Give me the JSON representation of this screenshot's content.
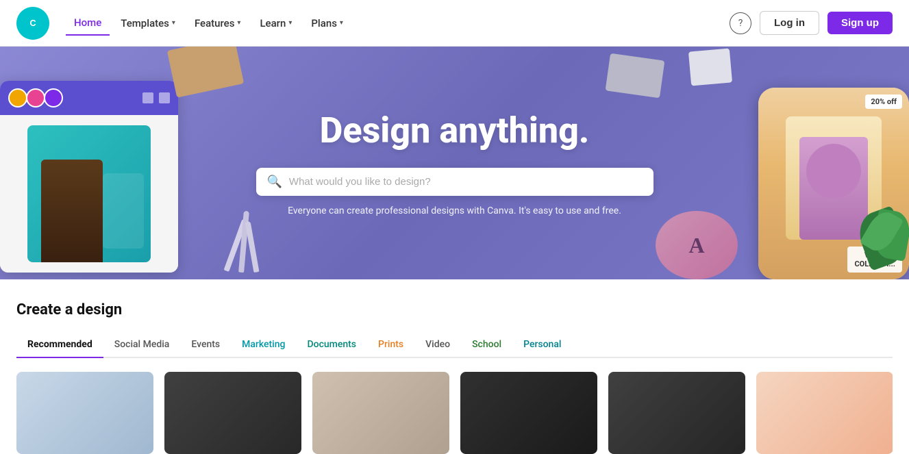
{
  "navbar": {
    "logo_alt": "Canva",
    "home_label": "Home",
    "templates_label": "Templates",
    "features_label": "Features",
    "learn_label": "Learn",
    "plans_label": "Plans",
    "help_label": "?",
    "login_label": "Log in",
    "signup_label": "Sign up"
  },
  "hero": {
    "title": "Design anything.",
    "search_placeholder": "What would you like to design?",
    "subtext": "Everyone can create professional designs with Canva. It's easy to use and free.",
    "sale_badge": "20% off",
    "vista_label": "VISTA\nCOLLECTI..."
  },
  "create_section": {
    "title": "Create a design",
    "tabs": [
      {
        "label": "Recommended",
        "active": true,
        "color": "default"
      },
      {
        "label": "Social Media",
        "active": false,
        "color": "default"
      },
      {
        "label": "Events",
        "active": false,
        "color": "default"
      },
      {
        "label": "Marketing",
        "active": false,
        "color": "teal"
      },
      {
        "label": "Documents",
        "active": false,
        "color": "teal2"
      },
      {
        "label": "Prints",
        "active": false,
        "color": "orange"
      },
      {
        "label": "Video",
        "active": false,
        "color": "default"
      },
      {
        "label": "School",
        "active": false,
        "color": "green"
      },
      {
        "label": "Personal",
        "active": false,
        "color": "teal3"
      }
    ],
    "thumbnails": [
      {
        "id": 1,
        "style": "thumb-1"
      },
      {
        "id": 2,
        "style": "thumb-2"
      },
      {
        "id": 3,
        "style": "thumb-3"
      },
      {
        "id": 4,
        "style": "thumb-4"
      },
      {
        "id": 5,
        "style": "thumb-5"
      },
      {
        "id": 6,
        "style": "thumb-6"
      }
    ]
  }
}
